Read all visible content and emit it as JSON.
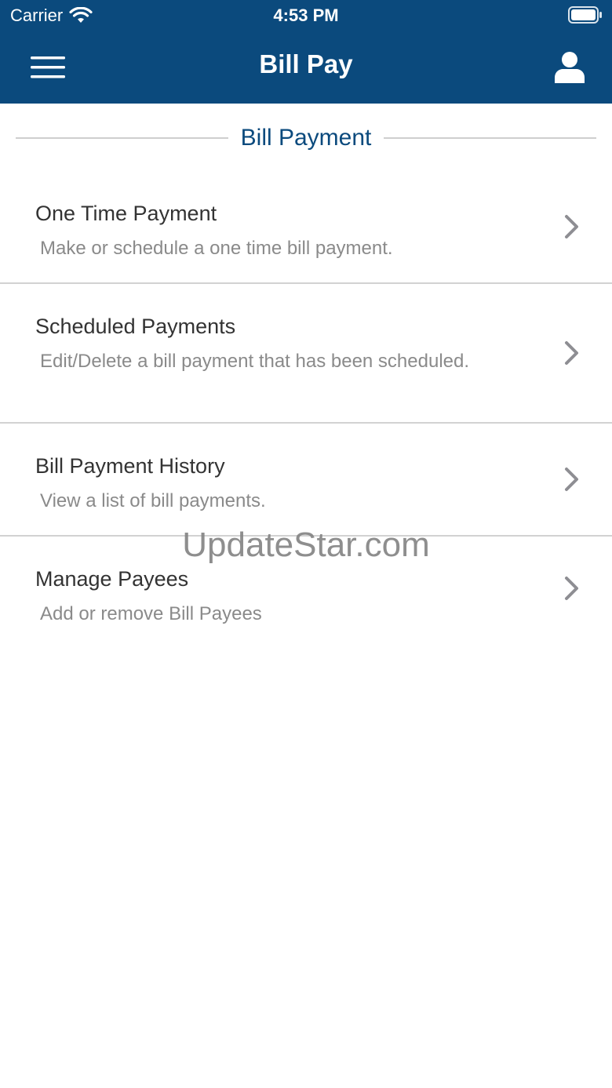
{
  "status_bar": {
    "carrier": "Carrier",
    "time": "4:53 PM"
  },
  "navbar": {
    "title": "Bill Pay",
    "menu_icon": "hamburger-menu-icon",
    "profile_icon": "user-profile-icon"
  },
  "section": {
    "title": "Bill Payment"
  },
  "items": [
    {
      "title": "One Time Payment",
      "description": "Make or schedule a one time bill payment."
    },
    {
      "title": "Scheduled Payments",
      "description": "Edit/Delete a bill payment that has been scheduled."
    },
    {
      "title": "Bill Payment History",
      "description": "View a list of bill payments."
    },
    {
      "title": "Manage Payees",
      "description": "Add or remove Bill Payees"
    }
  ],
  "watermark": "UpdateStar.com",
  "colors": {
    "header_bg": "#0b4a7d",
    "section_title": "#0b4a7d",
    "item_title": "#333333",
    "item_description": "#8a8a8a",
    "chevron": "#8e8e93",
    "divider": "#d2d2d2"
  }
}
